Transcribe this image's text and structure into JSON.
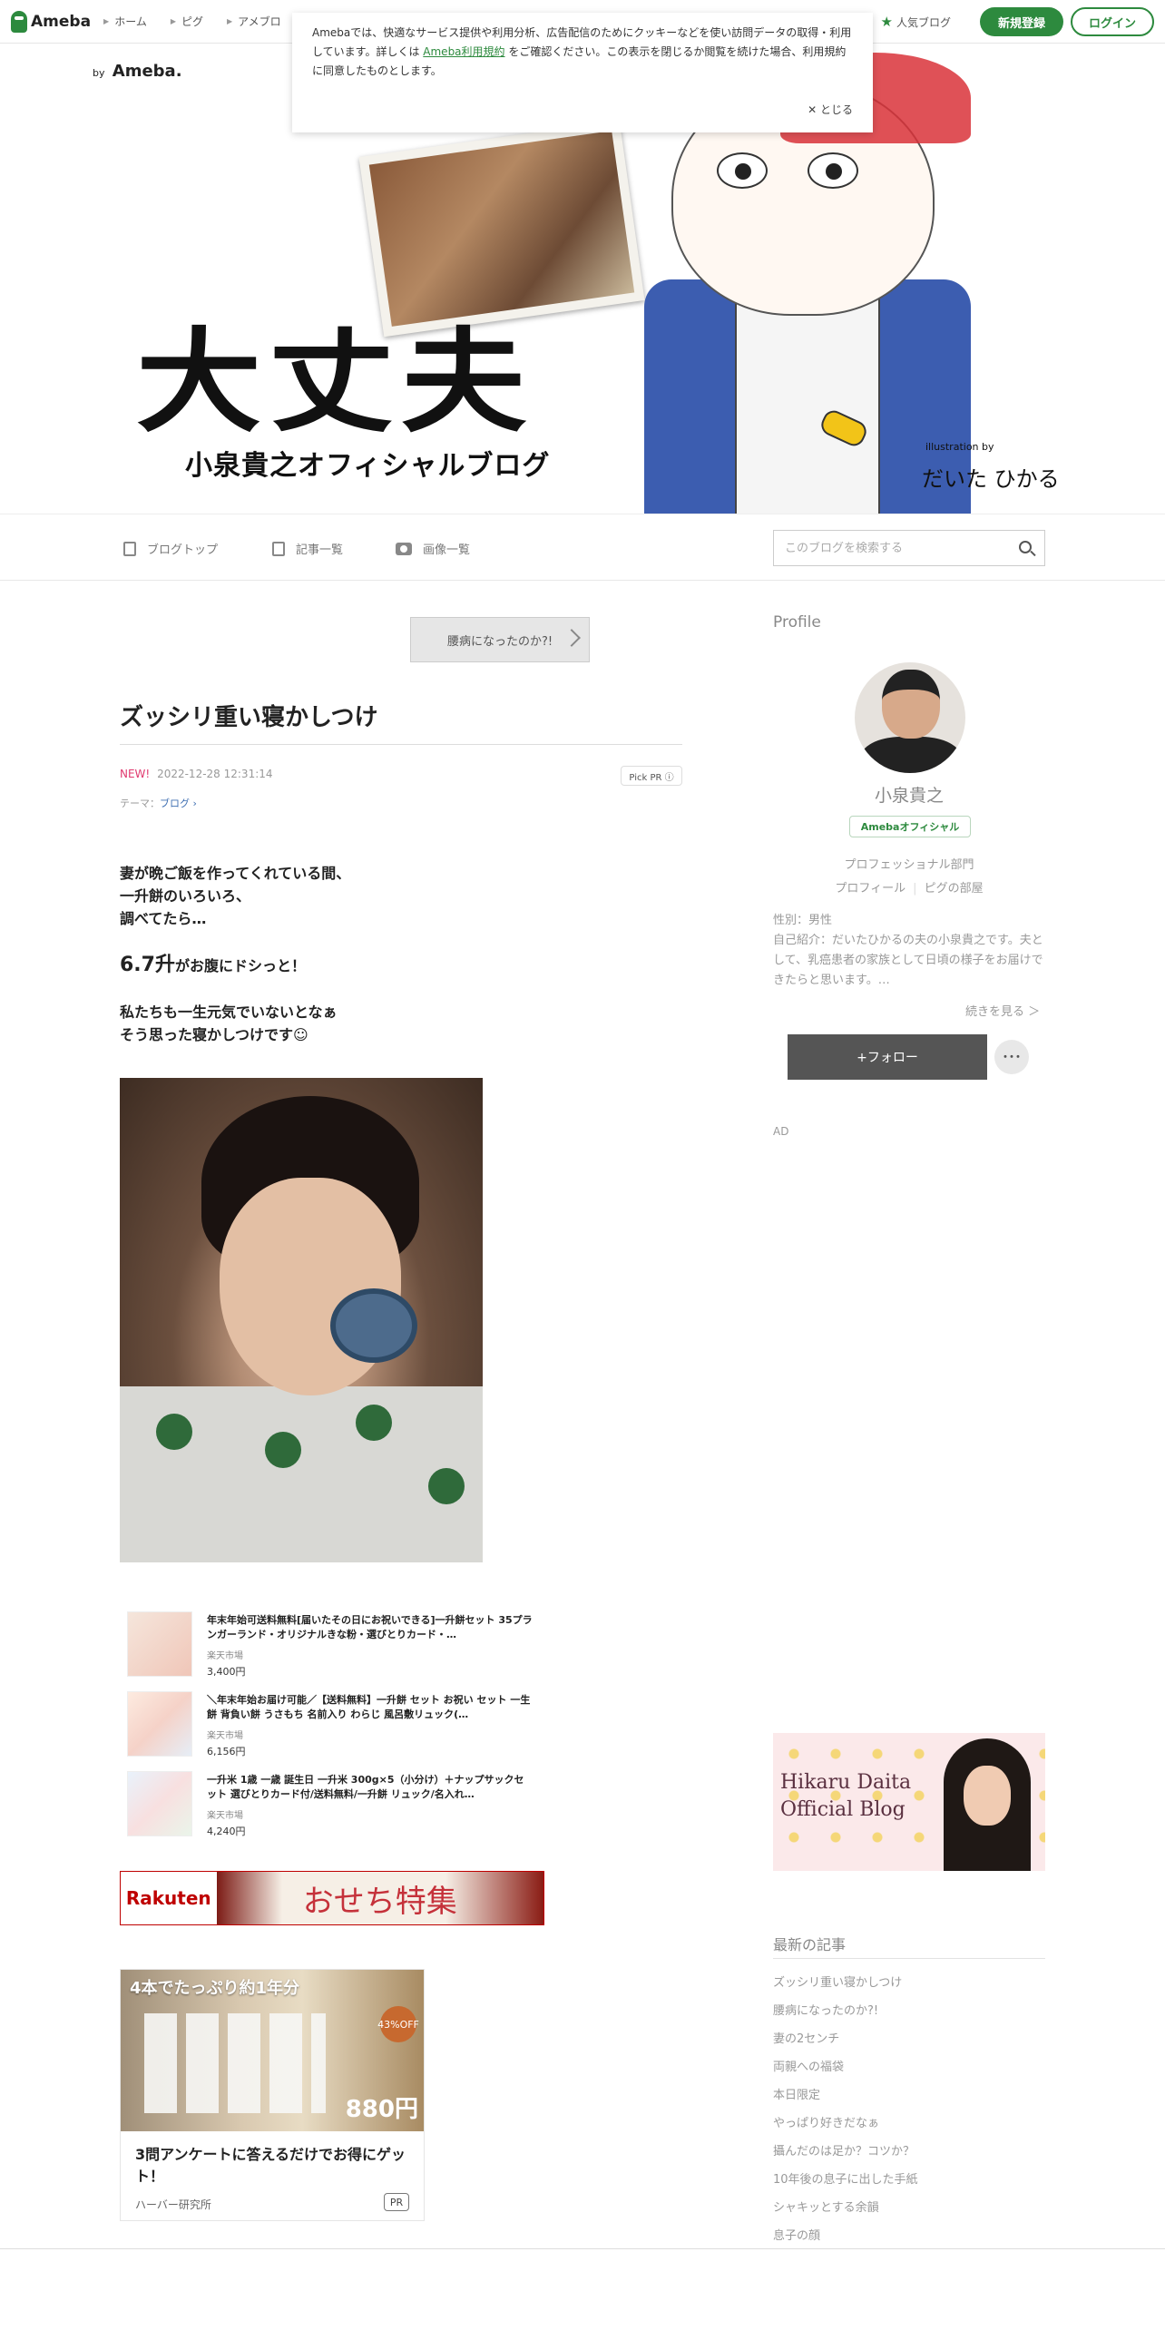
{
  "global_nav": {
    "logo": "Ameba",
    "links": [
      "ホーム",
      "ピグ",
      "アメブロ"
    ],
    "popular": "人気ブログ",
    "register": "新規登録",
    "login": "ログイン"
  },
  "cookie_notice": {
    "text_before": "Amebaでは、快適なサービス提供や利用分析、広告配信のためにクッキーなどを使い訪問データの取得・利用しています。詳しくは",
    "link": "Ameba利用規約",
    "text_after": "をご確認ください。この表示を閉じるか閲覧を続けた場合、利用規約に同意したものとします。",
    "close": "とじる"
  },
  "banner": {
    "by": "by",
    "brand": "Ameba.",
    "title": "大丈夫",
    "subtitle": "小泉貴之オフィシャルブログ",
    "credit": "illustration by",
    "credit_name": "だいた ひかる"
  },
  "blog_nav": {
    "top": "ブログトップ",
    "entries": "記事一覧",
    "images": "画像一覧",
    "search_placeholder": "このブログを検索する"
  },
  "article": {
    "prev": "腰病になったのか?!",
    "title": "ズッシリ重い寝かしつけ",
    "new_label": "NEW!",
    "date": "2022-12-28 12:31:14",
    "pick_pr": "Pick PR ⓘ",
    "theme_label": "テーマ：",
    "theme": "ブログ",
    "p1_l1": "妻が晩ご飯を作ってくれている間、",
    "p1_l2": "一升餅のいろいろ、",
    "p1_l3": "調べてたら…",
    "p2_big": "6.7升",
    "p2_rest": "がお腹にドシっと！",
    "p3_l1": "私たちも一生元気でいないとなぁ",
    "p3_l2": "そう思った寝かしつけです☺"
  },
  "products": [
    {
      "name": "年末年始可送料無料[届いたその日にお祝いできる]一升餅セット 35プランガーランド・オリジナルきな粉・選びとりカード・…",
      "shop": "楽天市場",
      "price": "3,400円"
    },
    {
      "name": "＼年末年始お届け可能／【送料無料】一升餅 セット お祝い セット 一生餅 背負い餅 うさもち 名前入り わらじ 風呂敷リュック(…",
      "shop": "楽天市場",
      "price": "6,156円"
    },
    {
      "name": "一升米 1歳 一歳 誕生日 一升米 300g×5（小分け）＋ナップサックセット 選びとりカード付/送料無料/一升餅 リュック/名入れ…",
      "shop": "楽天市場",
      "price": "4,240円"
    }
  ],
  "rakuten_ad": {
    "logo": "Rakuten",
    "text": "おせち特集"
  },
  "ad_card": {
    "headline": "4本でたっぷり約1年分",
    "off": "43%OFF",
    "price": "880円",
    "text": "3問アンケートに答えるだけでお得にゲット！",
    "sponsor": "ハーバー研究所",
    "pr": "PR"
  },
  "sidebar": {
    "profile_label": "Profile",
    "name": "小泉貴之",
    "badge": "Amebaオフィシャル",
    "dept": "プロフェッショナル部門",
    "link_profile": "プロフィール",
    "link_room": "ピグの部屋",
    "gender": "性別：男性",
    "intro": "自己紹介：だいたひかるの夫の小泉貴之です。夫として、乳癌患者の家族として日頃の様子をお届けできたらと思います。…",
    "more": "続きを見る ＞",
    "follow": "+フォロー",
    "dots": "･･･",
    "ad": "AD",
    "hikaru_l1": "Hikaru Daita",
    "hikaru_l2": "Official Blog",
    "latest_title": "最新の記事",
    "latest": [
      "ズッシリ重い寝かしつけ",
      "腰病になったのか?!",
      "妻の2センチ",
      "両親への福袋",
      "本日限定",
      "やっぱり好きだなぁ",
      "攝んだのは足か？コツか？",
      "10年後の息子に出した手紙",
      "シャキッとする余韻",
      "息子の顔"
    ]
  }
}
